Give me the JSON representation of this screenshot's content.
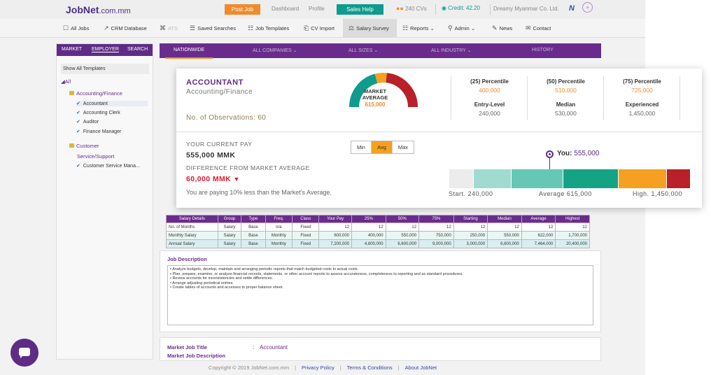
{
  "header": {
    "logo": "JobNet",
    "logo_domain": ".com.mm",
    "post_job": "Post Job",
    "dashboard": "Dashboard",
    "profile": "Profile",
    "sales_help": "Sales Help",
    "cvs": "240 CVs",
    "credit": "Credit: 42.20",
    "company": "Dreamy Myanmar Co. Ltd.",
    "partner_logo": "N"
  },
  "nav": [
    {
      "label": "All Jobs",
      "icon": "☐"
    },
    {
      "label": "CRM Database",
      "icon": "↗"
    },
    {
      "label": "ATS",
      "icon": "⌘"
    },
    {
      "label": "Saved Searches",
      "icon": "☰"
    },
    {
      "label": "Job Templates",
      "icon": "☷"
    },
    {
      "label": "CV Import",
      "icon": "⎗"
    },
    {
      "label": "Salary Survey",
      "icon": "⚖"
    },
    {
      "label": "Reports",
      "icon": "☷"
    },
    {
      "label": "Admin",
      "icon": "⚲"
    },
    {
      "label": "News",
      "icon": "✎"
    },
    {
      "label": "Contact",
      "icon": "✉"
    }
  ],
  "sidebar": {
    "tabs": [
      "MARKET",
      "EMPLOYER",
      "SEARCH"
    ],
    "show_all": "Show All Templates",
    "all": "All",
    "cat1": "Accounting/Finance",
    "cat1_items": [
      "Accountant",
      "Accounting Clerk",
      "Auditor",
      "Finance Manager"
    ],
    "cat2_line1": "Customer",
    "cat2_line2": "Service/Support",
    "cat2_items": [
      "Customer Service Mana..."
    ]
  },
  "subnav": {
    "items": [
      "NATIONWIDE",
      "ALL COMPANIES",
      "ALL SIZES",
      "ALL INDUSTRY",
      "HISTORY"
    ]
  },
  "summary": {
    "title": "ACCOUNTANT",
    "category": "Accounting/Finance",
    "observations": "No. of Observations: 60",
    "gauge_line1": "MARKET",
    "gauge_line2": "AVERAGE",
    "gauge_value": "615,000",
    "gauge_level": 0.42,
    "p25_label": "(25) Percentile",
    "p25_value": "400,000",
    "p50_label": "(50) Percentile",
    "p50_value": "510,000",
    "p75_label": "(75) Percentile",
    "p75_value": "725,000",
    "entry_label": "Entry-Level",
    "entry_value": "240,000",
    "median_label": "Median",
    "median_value": "530,000",
    "exp_label": "Experienced",
    "exp_value": "1,450,000",
    "current_pay_label": "YOUR CURRENT PAY",
    "current_pay": "555,000 MMK",
    "diff_label": "DIFFERENCE FROM MARKET AVERAGE",
    "diff_value": "60,000 MMK",
    "note": "You are paying 10% less than the Market's Average.",
    "toggle": [
      "Min",
      "Avg",
      "Max"
    ],
    "you_label": "You:",
    "you_value": "555,000",
    "start_label": "Start. 240,000",
    "avg_label": "Average 615,000",
    "high_label": "High. 1,450,000",
    "colors": {
      "purple": "#5e2c86",
      "orange": "#f5a020",
      "teal": "#0f9b8e",
      "red": "#b8202a"
    }
  },
  "table": {
    "headers": [
      "Salary Details",
      "Group",
      "Type",
      "Freq.",
      "Class",
      "Your Pay",
      "25%",
      "50%",
      "75%",
      "Starting",
      "Median",
      "Average",
      "Highest"
    ],
    "rows": [
      [
        "No. of Months",
        "Salary",
        "Base",
        "n/a",
        "Fixed",
        "12",
        "12",
        "12",
        "12",
        "12",
        "12",
        "12",
        "12"
      ],
      [
        "Monthly Salary",
        "Salary",
        "Base",
        "Monthly",
        "Fixed",
        "600,000",
        "400,000",
        "550,000",
        "750,000",
        "250,000",
        "550,000",
        "622,000",
        "1,700,000"
      ],
      [
        "Annual Salary",
        "Salary",
        "Base",
        "Monthly",
        "Fixed",
        "7,200,000",
        "4,800,000",
        "6,600,000",
        "9,000,000",
        "3,000,000",
        "6,600,000",
        "7,464,000",
        "20,400,000"
      ]
    ]
  },
  "job_description": {
    "title": "Job Description",
    "lines": [
      "• Analyze budgets, develop, maintain and arranging periodic reports that match budgeted costs to actual costs.",
      "• Plan, prepare, examine, or analyze financial records, statements, or other account reports to assess accurateness, completeness to reporting and as standard procedures.",
      "• Review accounts for inconsistencies and settle differences.",
      "• Arrange adjusting periodical entries.",
      "• Create tables of accounts and accesses to proper balance sheet."
    ]
  },
  "market": {
    "title_label": "Market Job Title",
    "title_value": "Accountant",
    "desc_label": "Market Job Description"
  },
  "footer": {
    "copyright": "Copyright © 2019 JobNet.com.mm",
    "privacy": "Privacy Policy",
    "terms": "Terms & Conditions",
    "about": "About JobNet"
  }
}
